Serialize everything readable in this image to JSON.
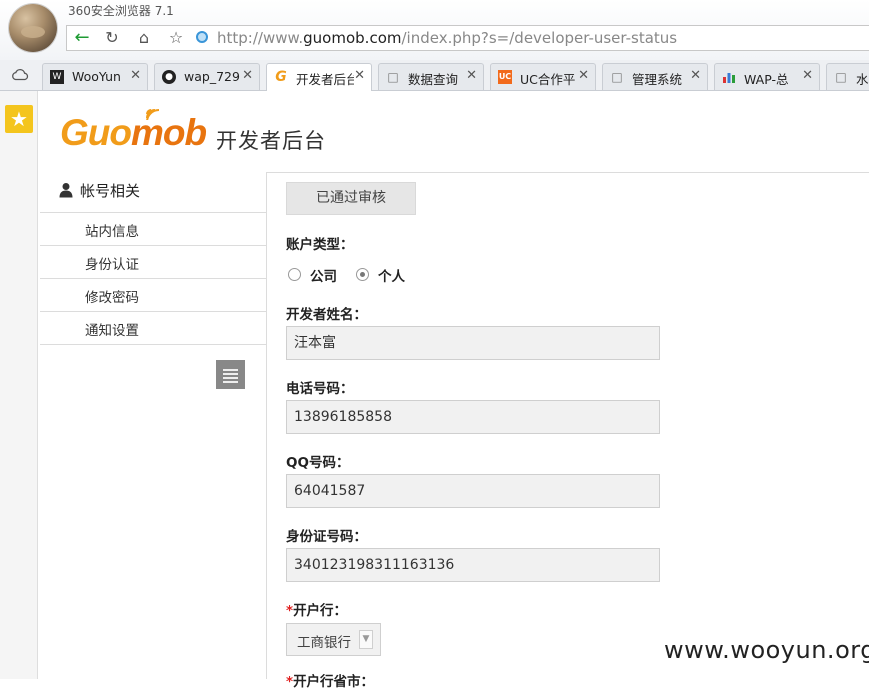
{
  "browser": {
    "title": "360安全浏览器 7.1",
    "url_prefix": "http://www.",
    "url_host": "guomob.com",
    "url_path": "/index.php?s=/developer-user-status"
  },
  "tabs": [
    {
      "label": "WooYun",
      "icon": "wooyun-icon"
    },
    {
      "label": "wap_729",
      "icon": "github-icon"
    },
    {
      "label": "开发者后台",
      "icon": "guomob-g-icon",
      "active": true
    },
    {
      "label": "数据查询",
      "icon": "document-icon"
    },
    {
      "label": "UC合作平",
      "icon": "uc-icon"
    },
    {
      "label": "管理系统",
      "icon": "document-icon"
    },
    {
      "label": "WAP-总",
      "icon": "bar-chart-icon"
    },
    {
      "label": "水",
      "icon": "document-icon"
    }
  ],
  "site": {
    "logo_text": "Guomob",
    "title": "开发者后台"
  },
  "sidebar": {
    "section_label": "帐号相关",
    "items": [
      {
        "label": "站内信息"
      },
      {
        "label": "身份认证"
      },
      {
        "label": "修改密码"
      },
      {
        "label": "通知设置"
      }
    ]
  },
  "form": {
    "status_button": "已通过审核",
    "account_type_label": "账户类型：",
    "account_type_options": [
      "公司",
      "个人"
    ],
    "account_type_selected": "个人",
    "name_label": "开发者姓名：",
    "name_value": "汪本富",
    "phone_label": "电话号码：",
    "phone_value": "13896185858",
    "qq_label": "QQ号码：",
    "qq_value": "64041587",
    "idcard_label": "身份证号码：",
    "idcard_value": "340123198311163136",
    "bank_label": "开户行：",
    "bank_value": "工商银行",
    "bank_province_label": "开户行省市："
  },
  "watermark": "www.wooyun.org",
  "colors": {
    "logo_orange": "#f19c1a",
    "required_star": "#e02020",
    "nav_back_green": "#1e9b33",
    "favorites_yellow": "#f4c51d"
  }
}
